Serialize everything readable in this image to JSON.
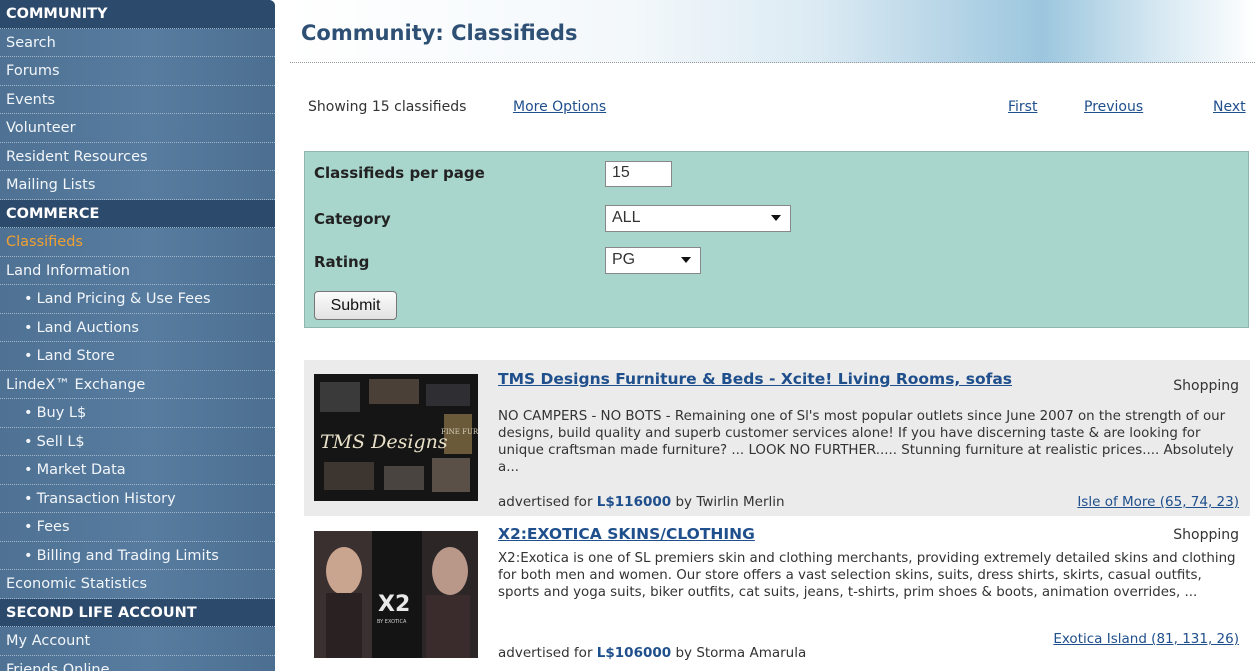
{
  "sidebar": {
    "rows": [
      {
        "label": "COMMUNITY",
        "type": "header"
      },
      {
        "label": "Search",
        "type": "item"
      },
      {
        "label": "Forums",
        "type": "item"
      },
      {
        "label": "Events",
        "type": "item"
      },
      {
        "label": "Volunteer",
        "type": "item"
      },
      {
        "label": "Resident Resources",
        "type": "item"
      },
      {
        "label": "Mailing Lists",
        "type": "item"
      },
      {
        "label": "COMMERCE",
        "type": "header"
      },
      {
        "label": "Classifieds",
        "type": "item",
        "active": true
      },
      {
        "label": "Land Information",
        "type": "item"
      },
      {
        "label": "Land Pricing & Use Fees",
        "type": "sub"
      },
      {
        "label": "Land Auctions",
        "type": "sub"
      },
      {
        "label": "Land Store",
        "type": "sub"
      },
      {
        "label": "LindeX™ Exchange",
        "type": "item"
      },
      {
        "label": "Buy L$",
        "type": "sub"
      },
      {
        "label": "Sell L$",
        "type": "sub"
      },
      {
        "label": "Market Data",
        "type": "sub"
      },
      {
        "label": "Transaction History",
        "type": "sub"
      },
      {
        "label": "Fees",
        "type": "sub"
      },
      {
        "label": "Billing and Trading Limits",
        "type": "sub"
      },
      {
        "label": "Economic Statistics",
        "type": "item"
      },
      {
        "label": "SECOND LIFE ACCOUNT",
        "type": "header"
      },
      {
        "label": "My Account",
        "type": "item"
      },
      {
        "label": "Friends Online",
        "type": "item"
      }
    ],
    "bullet": "•",
    "colors": {
      "header_bg": "#2c4a6c",
      "active_text": "#f0a030"
    }
  },
  "header": {
    "title": "Community: Classifieds"
  },
  "options": {
    "showing": "Showing 15 classifieds",
    "more_options": "More Options",
    "first": "First",
    "previous": "Previous",
    "next": "Next"
  },
  "filters": {
    "per_page_label": "Classifieds per page",
    "per_page_value": "15",
    "category_label": "Category",
    "category_value": "ALL",
    "rating_label": "Rating",
    "rating_value": "PG",
    "submit_label": "Submit",
    "panel_color": "#a8d5cc"
  },
  "listings": [
    {
      "title": "TMS Designs Furniture & Beds - Xcite! Living Rooms, sofas",
      "category": "Shopping",
      "description": "NO CAMPERS - NO BOTS - Remaining one of Sl's most popular outlets since June 2007 on the strength of our designs, build quality and superb customer services alone! If you have discerning taste & are looking for unique craftsman made furniture? ... LOOK NO FURTHER..... Stunning furniture at realistic prices.... Absolutely a...",
      "advertised_for": "advertised for",
      "price": "L$116000",
      "by": "by",
      "seller": "Twirlin Merlin",
      "location": "Isle of More (65, 74, 23)",
      "thumb_text": {
        "brand": "TMS Designs",
        "side": "FINE FURNISHINGS"
      }
    },
    {
      "title": "X2:EXOTICA SKINS/CLOTHING",
      "category": "Shopping",
      "description": "X2:Exotica is one of SL premiers skin and clothing merchants, providing extremely detailed skins and clothing for both men and women. Our store offers a vast selection skins, suits, dress shirts, skirts, casual outfits, sports and yoga suits, biker outfits, cat suits, jeans, t-shirts, prim shoes & boots, animation overrides, ...",
      "advertised_for": "advertised for",
      "price": "L$106000",
      "by": "by",
      "seller": "Storma Amarula",
      "location": "Exotica Island (81, 131, 26)",
      "thumb_text": {
        "brand": "X2",
        "side": "BY EXOTICA"
      }
    }
  ]
}
